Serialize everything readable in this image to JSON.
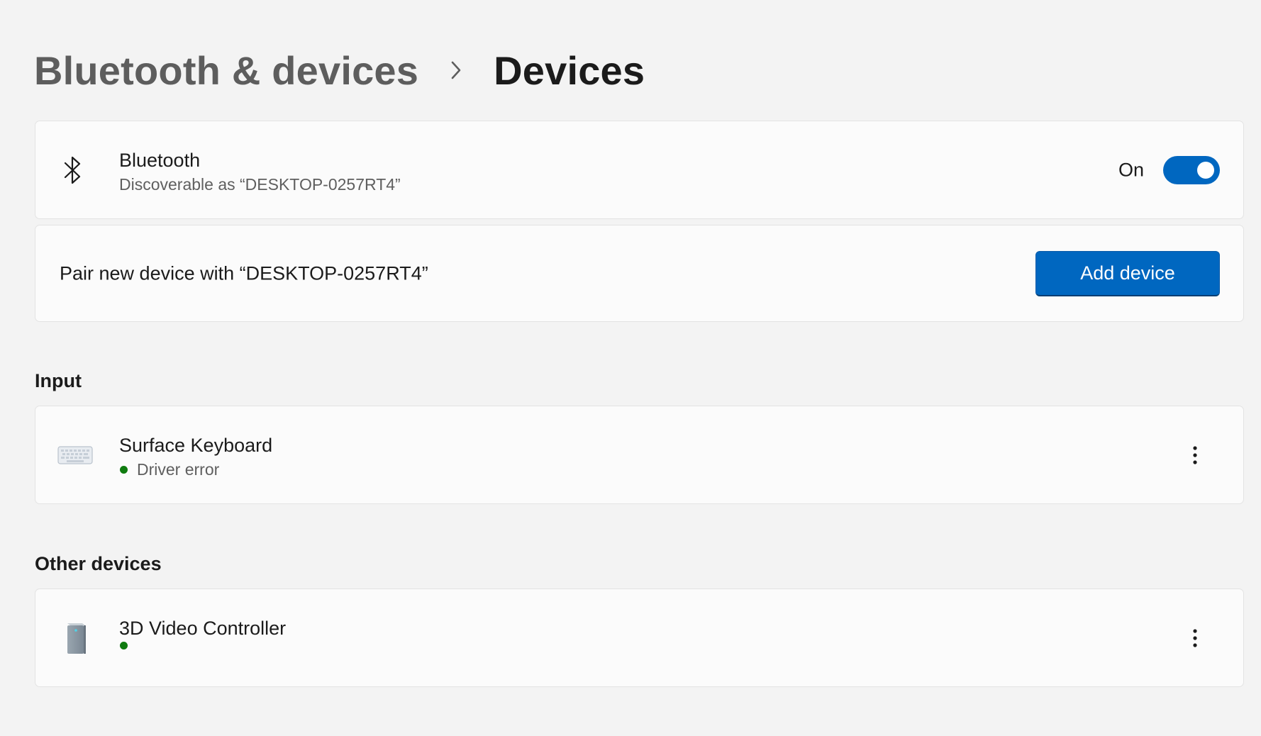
{
  "breadcrumb": {
    "parent": "Bluetooth & devices",
    "current": "Devices"
  },
  "bluetooth": {
    "icon": "bluetooth-icon",
    "title": "Bluetooth",
    "subtitle": "Discoverable as “DESKTOP-0257RT4”",
    "toggle_label": "On",
    "toggle_on": true
  },
  "pair": {
    "text": "Pair new device with “DESKTOP-0257RT4”",
    "button_label": "Add device"
  },
  "sections": {
    "input": {
      "header": "Input",
      "devices": [
        {
          "icon": "keyboard-icon",
          "name": "Surface Keyboard",
          "status": "Driver error",
          "status_color": "#0f7b0f"
        }
      ]
    },
    "other": {
      "header": "Other devices",
      "devices": [
        {
          "icon": "desktop-tower-icon",
          "name": "3D Video Controller",
          "status": "",
          "status_color": "#0f7b0f"
        }
      ]
    }
  },
  "colors": {
    "accent": "#0067c0",
    "background": "#f3f3f3",
    "card": "#fbfbfb"
  }
}
